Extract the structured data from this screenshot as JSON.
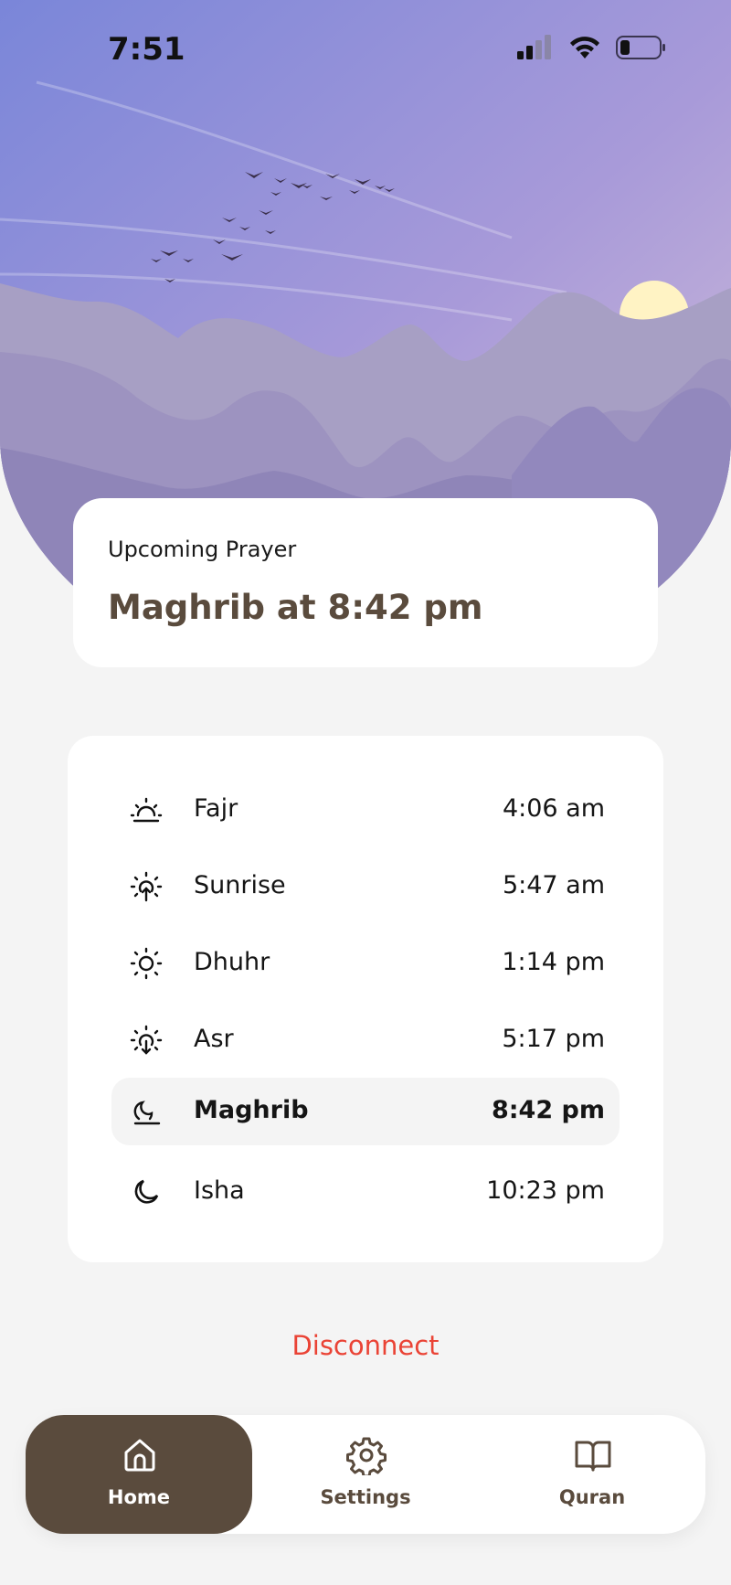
{
  "status_bar": {
    "time": "7:51",
    "icons": [
      "cellular-signal-icon",
      "wifi-icon",
      "battery-icon"
    ]
  },
  "upcoming": {
    "label": "Upcoming Prayer",
    "value": "Maghrib at 8:42 pm"
  },
  "prayers": [
    {
      "name": "Fajr",
      "time": "4:06 am",
      "icon": "fajr-icon"
    },
    {
      "name": "Sunrise",
      "time": "5:47 am",
      "icon": "sunrise-icon"
    },
    {
      "name": "Dhuhr",
      "time": "1:14 pm",
      "icon": "sun-icon"
    },
    {
      "name": "Asr",
      "time": "5:17 pm",
      "icon": "sunset-icon"
    },
    {
      "name": "Maghrib",
      "time": "8:42 pm",
      "icon": "moon-set-icon",
      "active": true
    },
    {
      "name": "Isha",
      "time": "10:23 pm",
      "icon": "moon-icon"
    }
  ],
  "disconnect_label": "Disconnect",
  "tabs": [
    {
      "label": "Home",
      "icon": "home-icon",
      "active": true
    },
    {
      "label": "Settings",
      "icon": "gear-icon"
    },
    {
      "label": "Quran",
      "icon": "book-icon"
    }
  ],
  "colors": {
    "accent": "#5a4b3d",
    "danger": "#ea4335",
    "background": "#f4f4f4",
    "sky_top": "#7a86d9",
    "sky_bottom": "#b9a7d9",
    "sun": "#fff3c4"
  }
}
